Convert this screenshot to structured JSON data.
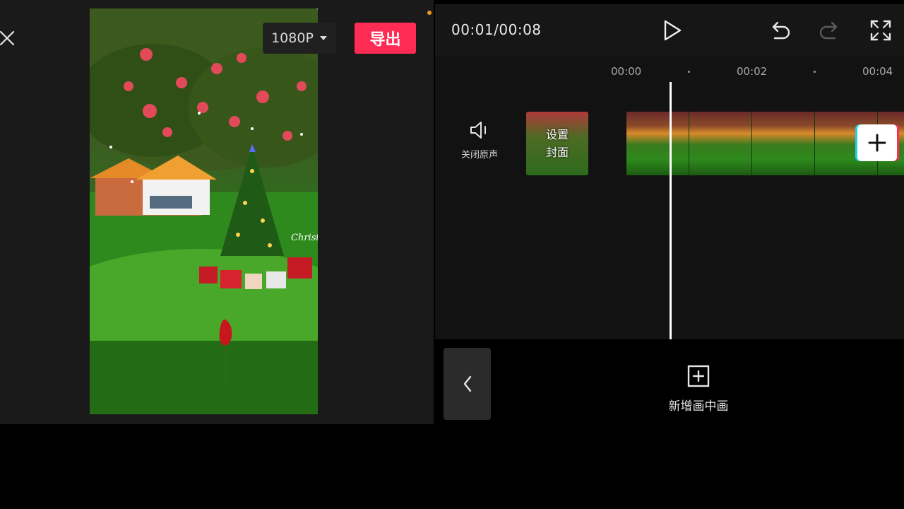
{
  "preview": {
    "close_icon": "close-icon",
    "resolution_label": "1080P",
    "resolution_icon": "caret-down-icon",
    "export_label": "导出",
    "accent_color": "#fe2c55",
    "watermark_text": "Christm"
  },
  "toolbar": {
    "timecode": "00:01/00:08",
    "play_icon": "play-icon",
    "undo_icon": "undo-icon",
    "redo_icon": "redo-icon",
    "fullscreen_icon": "fullscreen-icon"
  },
  "timeline": {
    "ticks": [
      "00:00",
      "00:02",
      "00:04"
    ],
    "mute_label": "关闭原声",
    "cover_label_line1": "设置",
    "cover_label_line2": "封面",
    "add_clip_icon": "plus-icon"
  },
  "bottom": {
    "back_icon": "chevron-left-icon",
    "pip_label": "新增画中画",
    "pip_icon": "add-square-icon"
  }
}
